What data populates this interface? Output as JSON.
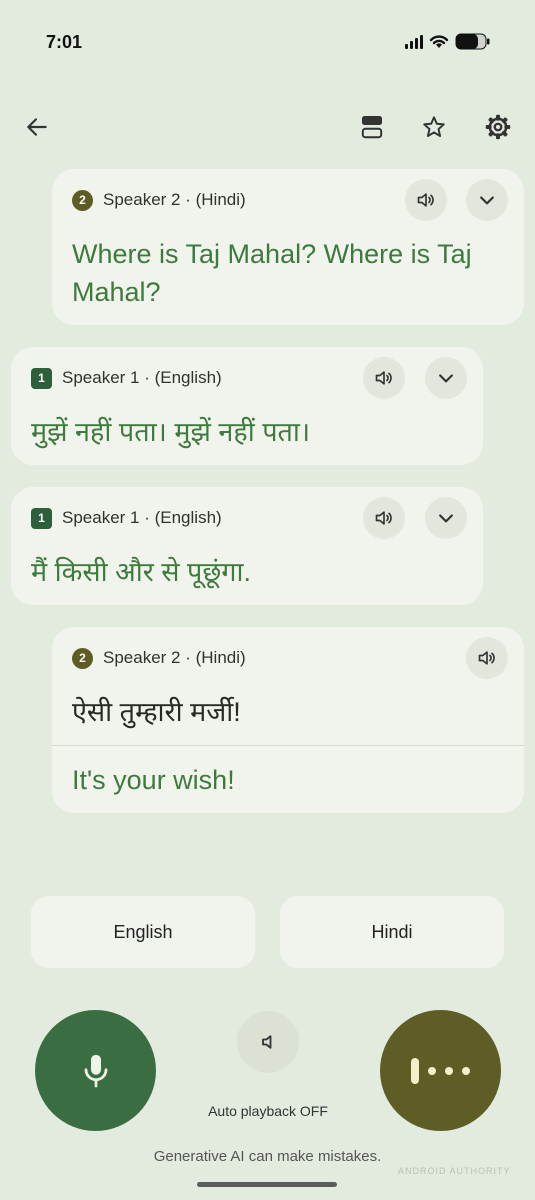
{
  "status": {
    "time": "7:01"
  },
  "icons": {
    "back": "arrow-back-icon",
    "layout": "split-view-icon",
    "favorite": "star-outline-icon",
    "settings": "gear-icon",
    "speaker": "volume-icon",
    "expand": "chevron-down-icon",
    "mic": "microphone-icon",
    "mute": "speaker-muted-icon",
    "more": "more-dots-icon"
  },
  "messages": [
    {
      "badge": "2",
      "speaker": "Speaker 2 · (Hindi)",
      "text": "Where is Taj Mahal? Where is Taj Mahal?"
    },
    {
      "badge": "1",
      "speaker": "Speaker 1 · (English)",
      "text": "मुझें नहीं पता। मुझें नहीं पता।"
    },
    {
      "badge": "1",
      "speaker": "Speaker 1 · (English)",
      "text": "मैं किसी और से पूछूंगा."
    },
    {
      "badge": "2",
      "speaker": "Speaker 2 · (Hindi)",
      "original": "ऐसी तुम्हारी मर्जी!",
      "translation": "It's your wish!"
    }
  ],
  "languages": {
    "left": "English",
    "right": "Hindi"
  },
  "autoplay_label": "Auto playback OFF",
  "disclaimer": "Generative AI can make mistakes.",
  "watermark": "ANDROID AUTHORITY",
  "colors": {
    "background": "#e3ebdf",
    "card": "#f1f4ec",
    "green_text": "#3e7a3e",
    "mic_button": "#3a6e42",
    "more_button": "#5e5d25"
  }
}
